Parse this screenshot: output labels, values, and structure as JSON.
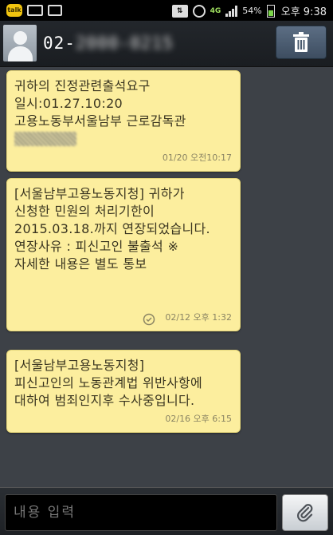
{
  "status_bar": {
    "talk_badge": "talk",
    "network": "4G",
    "battery_percent": "54%",
    "battery_level": 0.54,
    "time": "오후 9:38",
    "icons": [
      "kakaotalk-icon",
      "mail-icon",
      "gallery-icon",
      "data-icon",
      "alarm-icon",
      "signal-icon",
      "battery-icon"
    ]
  },
  "header": {
    "contact_prefix": "02-",
    "contact_hidden": "2000-0215",
    "delete_icon": "trash-icon"
  },
  "messages": [
    {
      "lines": "귀하의 진정관련출석요구\n일시:01.27.10:20\n고용노동부서울남부 근로감독관",
      "has_redaction": true,
      "time": "01/20 오전10:17"
    },
    {
      "lines": "[서울남부고용노동지청] 귀하가\n신청한 민원의 처리기한이\n2015.03.18.까지 연장되었습니다.\n연장사유 : 피신고인 불출석 ※\n자세한 내용은 별도 통보",
      "has_status_icon": true,
      "time": "02/12 오후 1:32"
    },
    {
      "lines": "[서울남부고용노동지청]\n피신고인의 노동관계법 위반사항에\n대하여 범죄인지후 수사중입니다.",
      "time": "02/16 오후 6:15"
    }
  ],
  "input": {
    "placeholder": "내용 입력",
    "attach_icon": "paperclip-icon"
  },
  "colors": {
    "bubble": "#fcee9e",
    "background": "#3d4147",
    "header": "#1e2226"
  }
}
